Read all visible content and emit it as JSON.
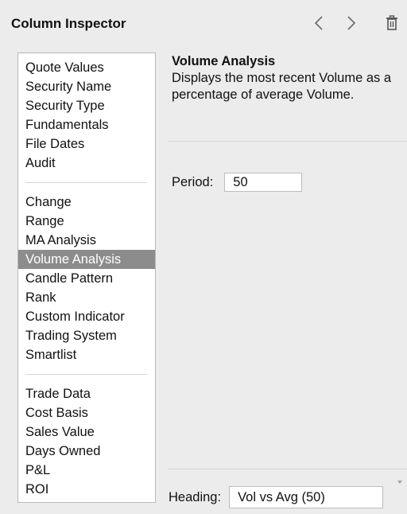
{
  "header": {
    "title": "Column Inspector",
    "back_icon": "chevron-left-icon",
    "forward_icon": "chevron-right-icon",
    "delete_icon": "trash-icon"
  },
  "list": {
    "groups": [
      [
        "Quote Values",
        "Security Name",
        "Security Type",
        "Fundamentals",
        "File Dates",
        "Audit"
      ],
      [
        "Change",
        "Range",
        "MA Analysis",
        "Volume Analysis",
        "Candle Pattern",
        "Rank",
        "Custom Indicator",
        "Trading System",
        "Smartlist"
      ],
      [
        "Trade Data",
        "Cost Basis",
        "Sales Value",
        "Days Owned",
        "P&L",
        "ROI"
      ]
    ],
    "selected": "Volume Analysis"
  },
  "detail": {
    "title": "Volume Analysis",
    "description": "Displays the most recent Volume as a percentage of average Volume.",
    "period_label": "Period:",
    "period_value": "50",
    "heading_label": "Heading:",
    "heading_value": "Vol vs Avg (50)"
  },
  "colors": {
    "background": "#ececec",
    "selected_row": "#8c8c8c"
  }
}
